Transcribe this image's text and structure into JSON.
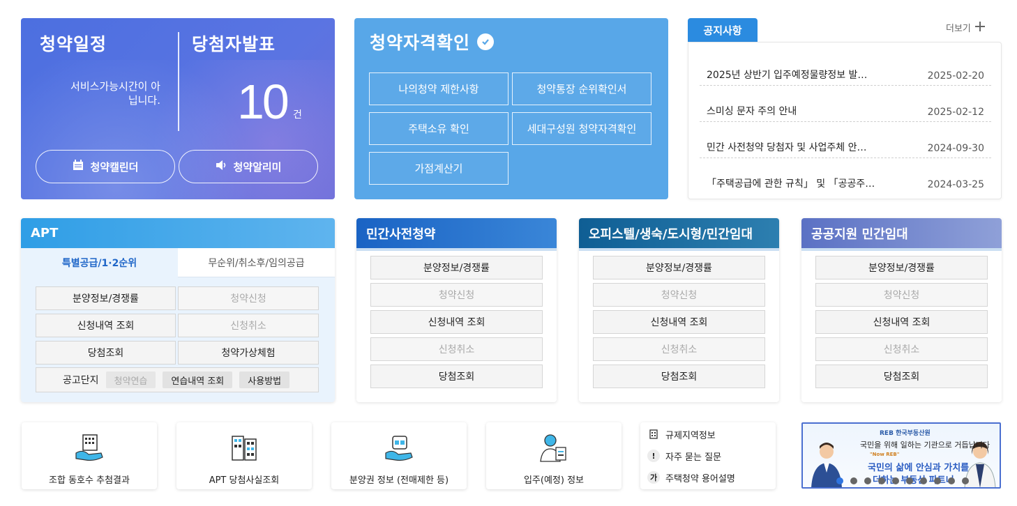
{
  "schedule": {
    "title": "청약일정",
    "message": "서비스가능시간이 아닙니다.",
    "calendar_button": "청약캘린더",
    "alert_button": "청약알리미"
  },
  "winners": {
    "title": "당첨자발표",
    "count": "10",
    "unit": "건"
  },
  "eligibility": {
    "title": "청약자격확인",
    "buttons": [
      "나의청약 제한사항",
      "청약통장 순위확인서",
      "주택소유 확인",
      "세대구성원 청약자격확인",
      "가점계산기"
    ]
  },
  "notice": {
    "tab": "공지사항",
    "more": "더보기",
    "items": [
      {
        "title": "2025년 상반기 입주예정물량정보 발…",
        "date": "2025-02-20"
      },
      {
        "title": "스미싱 문자 주의 안내",
        "date": "2025-02-12"
      },
      {
        "title": "민간 사전청약 당첨자 및 사업주체 안…",
        "date": "2024-09-30"
      },
      {
        "title": "「주택공급에 관한 규칙」 및 「공공주…",
        "date": "2024-03-25"
      }
    ]
  },
  "apt": {
    "title": "APT",
    "tab_active": "특별공급/1·2순위",
    "tab_inactive": "무순위/취소후/임의공급",
    "buttons": [
      "분양정보/경쟁률",
      "청약신청",
      "신청내역 조회",
      "신청취소",
      "당첨조회",
      "청약가상체험"
    ],
    "bottom_label": "공고단지",
    "chips": [
      "청약연습",
      "연습내역 조회",
      "사용방법"
    ]
  },
  "private_presale": {
    "title": "민간사전청약",
    "buttons": [
      "분양정보/경쟁률",
      "청약신청",
      "신청내역 조회",
      "신청취소",
      "당첨조회"
    ]
  },
  "officetel": {
    "title": "오피스텔/생숙/도시형/민간임대",
    "buttons": [
      "분양정보/경쟁률",
      "청약신청",
      "신청내역 조회",
      "신청취소",
      "당첨조회"
    ]
  },
  "public_rental": {
    "title": "공공지원 민간임대",
    "buttons": [
      "분양정보/경쟁률",
      "청약신청",
      "신청내역 조회",
      "신청취소",
      "당첨조회"
    ]
  },
  "quick": {
    "cards": [
      "조합 동호수 추첨결과",
      "APT 당첨사실조회",
      "분양권 정보 (전매제한 등)",
      "입주(예정) 정보"
    ],
    "links": [
      "규제지역정보",
      "자주 묻는 질문",
      "주택청약 용어설명"
    ],
    "link_icons": [
      "building-icon",
      "exclamation-icon",
      "ga-icon"
    ]
  },
  "banner": {
    "brand": "REB 한국부동산원",
    "line1": "국민을 위해 일하는 기관으로 거듭납니다",
    "tag": "\"Now REB\"",
    "line2": "국민의 삶에 안심과 가치를",
    "line3": "더하는 부동산 파트너"
  },
  "colors": {
    "schedule_bg": "#5a74e2",
    "eligibility_bg": "#58a7e8",
    "notice_tab": "#2b8be0",
    "apt_head": "#2f9ee6",
    "private_head": "#1a63c4",
    "officetel_head": "#0f5e94",
    "public_head": "#5b71c4"
  }
}
